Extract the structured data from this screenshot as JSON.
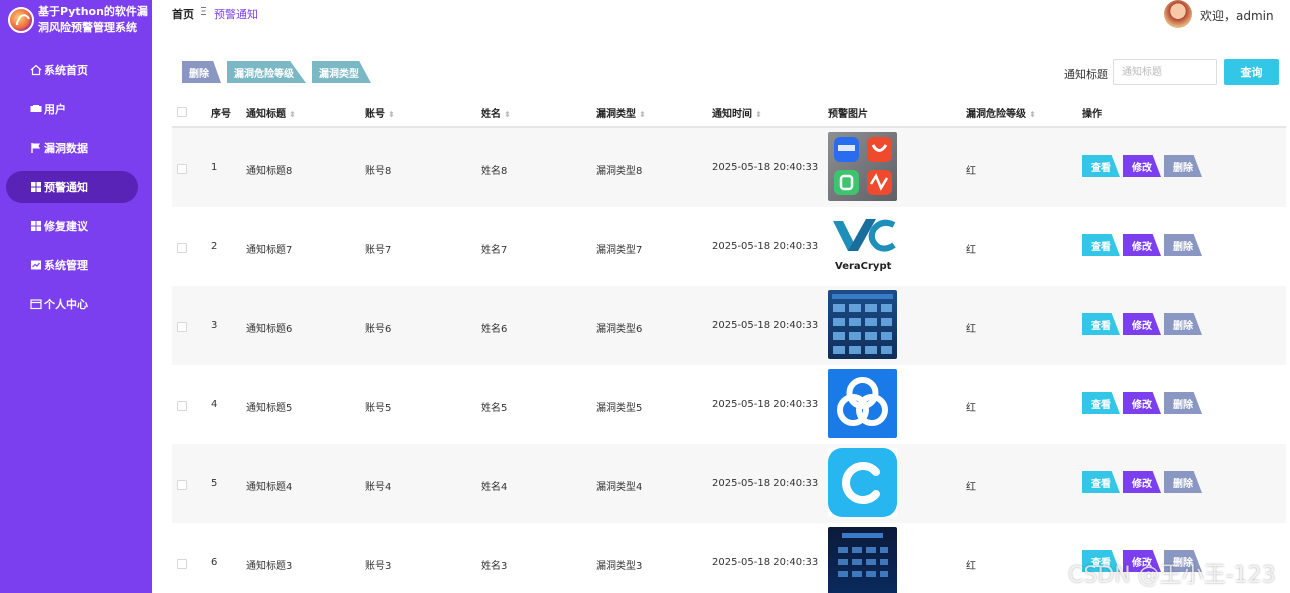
{
  "app": {
    "title": "基于Python的软件漏洞风险预警管理系统"
  },
  "sidebar": {
    "items": [
      {
        "label": "系统首页",
        "icon": "home-icon"
      },
      {
        "label": "用户",
        "icon": "user-icon"
      },
      {
        "label": "漏洞数据",
        "icon": "flag-icon"
      },
      {
        "label": "预警通知",
        "icon": "grid-icon",
        "active": true
      },
      {
        "label": "修复建议",
        "icon": "grid-icon"
      },
      {
        "label": "系统管理",
        "icon": "chart-icon"
      },
      {
        "label": "个人中心",
        "icon": "card-icon"
      }
    ]
  },
  "header": {
    "breadcrumb_home": "首页",
    "breadcrumb_sep": "Ξ",
    "breadcrumb_current": "预警通知",
    "welcome": "欢迎，admin"
  },
  "toolbar": {
    "delete_label": "删除",
    "level_label": "漏洞危险等级",
    "type_label": "漏洞类型"
  },
  "search": {
    "label": "通知标题",
    "placeholder": "通知标题",
    "button": "查询"
  },
  "table": {
    "headers": {
      "index": "序号",
      "title": "通知标题",
      "account": "账号",
      "name": "姓名",
      "vuln_type": "漏洞类型",
      "time": "通知时间",
      "image": "预警图片",
      "level": "漏洞危险等级",
      "ops": "操作"
    },
    "actions": {
      "view": "查看",
      "edit": "修改",
      "remove": "删除"
    },
    "rows": [
      {
        "index": "1",
        "title": "通知标题8",
        "account": "账号8",
        "name": "姓名8",
        "vuln_type": "漏洞类型8",
        "time": "2025-05-18 20:40:33",
        "level": "红"
      },
      {
        "index": "2",
        "title": "通知标题7",
        "account": "账号7",
        "name": "姓名7",
        "vuln_type": "漏洞类型7",
        "time": "2025-05-18 20:40:33",
        "level": "红",
        "image_text": "VeraCrypt"
      },
      {
        "index": "3",
        "title": "通知标题6",
        "account": "账号6",
        "name": "姓名6",
        "vuln_type": "漏洞类型6",
        "time": "2025-05-18 20:40:33",
        "level": "红"
      },
      {
        "index": "4",
        "title": "通知标题5",
        "account": "账号5",
        "name": "姓名5",
        "vuln_type": "漏洞类型5",
        "time": "2025-05-18 20:40:33",
        "level": "红"
      },
      {
        "index": "5",
        "title": "通知标题4",
        "account": "账号4",
        "name": "姓名4",
        "vuln_type": "漏洞类型4",
        "time": "2025-05-18 20:40:33",
        "level": "红"
      },
      {
        "index": "6",
        "title": "通知标题3",
        "account": "账号3",
        "name": "姓名3",
        "vuln_type": "漏洞类型3",
        "time": "2025-05-18 20:40:33",
        "level": "红"
      }
    ]
  },
  "watermark": "CSDN @王小王-123",
  "colors": {
    "sidebar": "#7b3ff0",
    "accent_cyan": "#34c6e6",
    "accent_purple": "#7b3ff0",
    "muted_blue": "#8a97c2",
    "teal": "#79b8c4"
  }
}
